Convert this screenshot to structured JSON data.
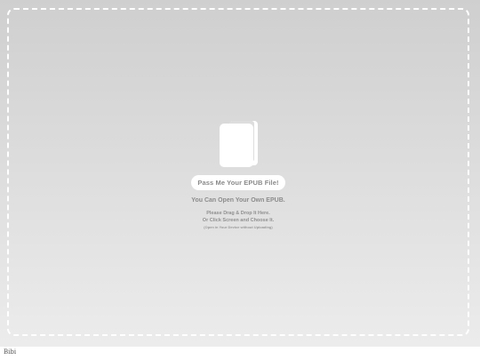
{
  "dropzone": {
    "icon": "book-icon",
    "pill_label": "Pass Me Your EPUB File!",
    "headline": "You Can Open Your Own EPUB.",
    "line1": "Please Drag & Drop It Here.",
    "line2": "Or Click Screen and Choose It.",
    "note": "(Open in Your Device without Uploading)"
  },
  "footer": {
    "label": "Bibi"
  },
  "colors": {
    "background_top": "#cfcfcf",
    "background_bottom": "#ececec",
    "dash_border": "#ffffff",
    "text": "#8c8c8c"
  }
}
